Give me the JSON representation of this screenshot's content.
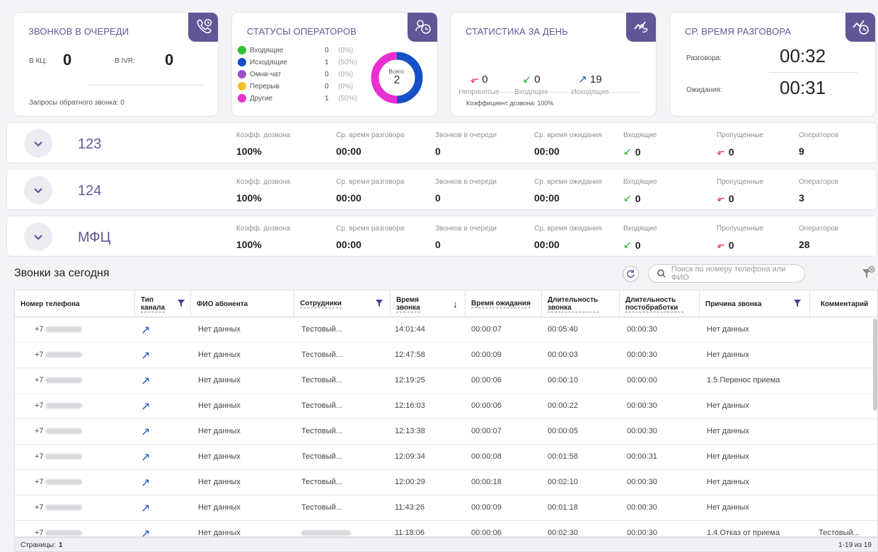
{
  "queue_card": {
    "title": "ЗВОНКОВ В ОЧЕРЕДИ",
    "kc_label": "В КЦ:",
    "kc_value": "0",
    "ivr_label": "В IVR:",
    "ivr_value": "0",
    "callback_label": "Запросы обратного звонка: 0"
  },
  "status_card": {
    "title": "СТАТУСЫ ОПЕРАТОРОВ",
    "total_label": "Всего:",
    "total_value": "2",
    "items": [
      {
        "label": "Входящие",
        "count": "0",
        "pct": "(0%)",
        "color": "#2ec02e",
        "value": 0
      },
      {
        "label": "Исходящие",
        "count": "1",
        "pct": "(50%)",
        "color": "#1450c8",
        "value": 1
      },
      {
        "label": "Омни-чат",
        "count": "0",
        "pct": "(0%)",
        "color": "#9b4fc8",
        "value": 0
      },
      {
        "label": "Перерыв",
        "count": "0",
        "pct": "(0%)",
        "color": "#f5c12e",
        "value": 0
      },
      {
        "label": "Другие",
        "count": "1",
        "pct": "(50%)",
        "color": "#e92fd2",
        "value": 1
      }
    ]
  },
  "day_card": {
    "title": "СТАТИСТИКА ЗА ДЕНЬ",
    "missed_value": "0",
    "missed_label": "Непринятые",
    "in_value": "0",
    "in_label": "Входящие",
    "out_value": "19",
    "out_label": "Исходящие",
    "rate_label": "Коэффициент дозвона: 100%"
  },
  "talk_card": {
    "title": "СР. ВРЕМЯ РАЗГОВОРА",
    "talk_label": "Разговора:",
    "talk_value": "00:32",
    "wait_label": "Ожидания:",
    "wait_value": "00:31"
  },
  "metric_labels": {
    "rate": "Коэфф. дозвона",
    "talk": "Ср. время разговора",
    "queue": "Звонков в очереди",
    "wait": "Ср. время ожидания",
    "in": "Входящие",
    "missed": "Пропущенные",
    "ops": "Операторов"
  },
  "groups": [
    {
      "name": "123",
      "rate": "100%",
      "talk": "00:00",
      "queue": "0",
      "wait": "00:00",
      "in": "0",
      "missed": "0",
      "ops": "9"
    },
    {
      "name": "124",
      "rate": "100%",
      "talk": "00:00",
      "queue": "0",
      "wait": "00:00",
      "in": "0",
      "missed": "0",
      "ops": "3"
    },
    {
      "name": "МФЦ",
      "rate": "100%",
      "talk": "00:00",
      "queue": "0",
      "wait": "00:00",
      "in": "0",
      "missed": "0",
      "ops": "28"
    }
  ],
  "calls": {
    "title": "Звонки за сегодня",
    "search_placeholder": "Поиск по номеру телефона или ФИО",
    "columns": {
      "phone": "Номер телефона",
      "channel": "Тип канала",
      "name": "ФИО абонента",
      "staff": "Сотрудники",
      "time": "Время звонка",
      "wait": "Время ожидания",
      "duration": "Длительность звонка",
      "post": "Длительность постобработки",
      "reason": "Причина звонка",
      "comment": "Комментарий"
    },
    "rows": [
      {
        "phone": "+7",
        "name": "Нет данных",
        "staff": "Тестовый...",
        "time": "14:01:44",
        "wait": "00:00:07",
        "duration": "00:05:40",
        "post": "00:00:30",
        "reason": "Нет данных",
        "comment": ""
      },
      {
        "phone": "+7",
        "name": "Нет данных",
        "staff": "Тестовый...",
        "time": "12:47:58",
        "wait": "00:00:09",
        "duration": "00:00:03",
        "post": "00:00:30",
        "reason": "Нет данных",
        "comment": ""
      },
      {
        "phone": "+7",
        "name": "Нет данных",
        "staff": "Тестовый...",
        "time": "12:19:25",
        "wait": "00:00:06",
        "duration": "00:00:10",
        "post": "00:00:00",
        "reason": "1.5.Перенос приема",
        "comment": ""
      },
      {
        "phone": "+7",
        "name": "Нет данных",
        "staff": "Тестовый...",
        "time": "12:16:03",
        "wait": "00:00:06",
        "duration": "00:00:22",
        "post": "00:00:30",
        "reason": "Нет данных",
        "comment": ""
      },
      {
        "phone": "+7",
        "name": "Нет данных",
        "staff": "Тестовый...",
        "time": "12:13:38",
        "wait": "00:00:07",
        "duration": "00:00:05",
        "post": "00:00:30",
        "reason": "Нет данных",
        "comment": ""
      },
      {
        "phone": "+7",
        "name": "Нет данных",
        "staff": "Тестовый...",
        "time": "12:09:34",
        "wait": "00:00:08",
        "duration": "00:01:58",
        "post": "00:00:31",
        "reason": "Нет данных",
        "comment": ""
      },
      {
        "phone": "+7",
        "name": "Нет данных",
        "staff": "Тестовый...",
        "time": "12:00:29",
        "wait": "00:00:18",
        "duration": "00:02:10",
        "post": "00:00:30",
        "reason": "Нет данных",
        "comment": ""
      },
      {
        "phone": "+7",
        "name": "Нет данных",
        "staff": "Тестовый...",
        "time": "11:43:26",
        "wait": "00:00:09",
        "duration": "00:01:18",
        "post": "00:00:30",
        "reason": "Нет данных",
        "comment": ""
      },
      {
        "phone": "+7",
        "name": "Нет данных",
        "staff": "",
        "time": "11:18:06",
        "wait": "00:00:06",
        "duration": "00:02:30",
        "post": "00:00:30",
        "reason": "1.4.Отказ от приема",
        "comment": "Тестовый..."
      }
    ],
    "pages_label": "Страницы:",
    "pages_value": "1",
    "range": "1-19 из 19"
  }
}
